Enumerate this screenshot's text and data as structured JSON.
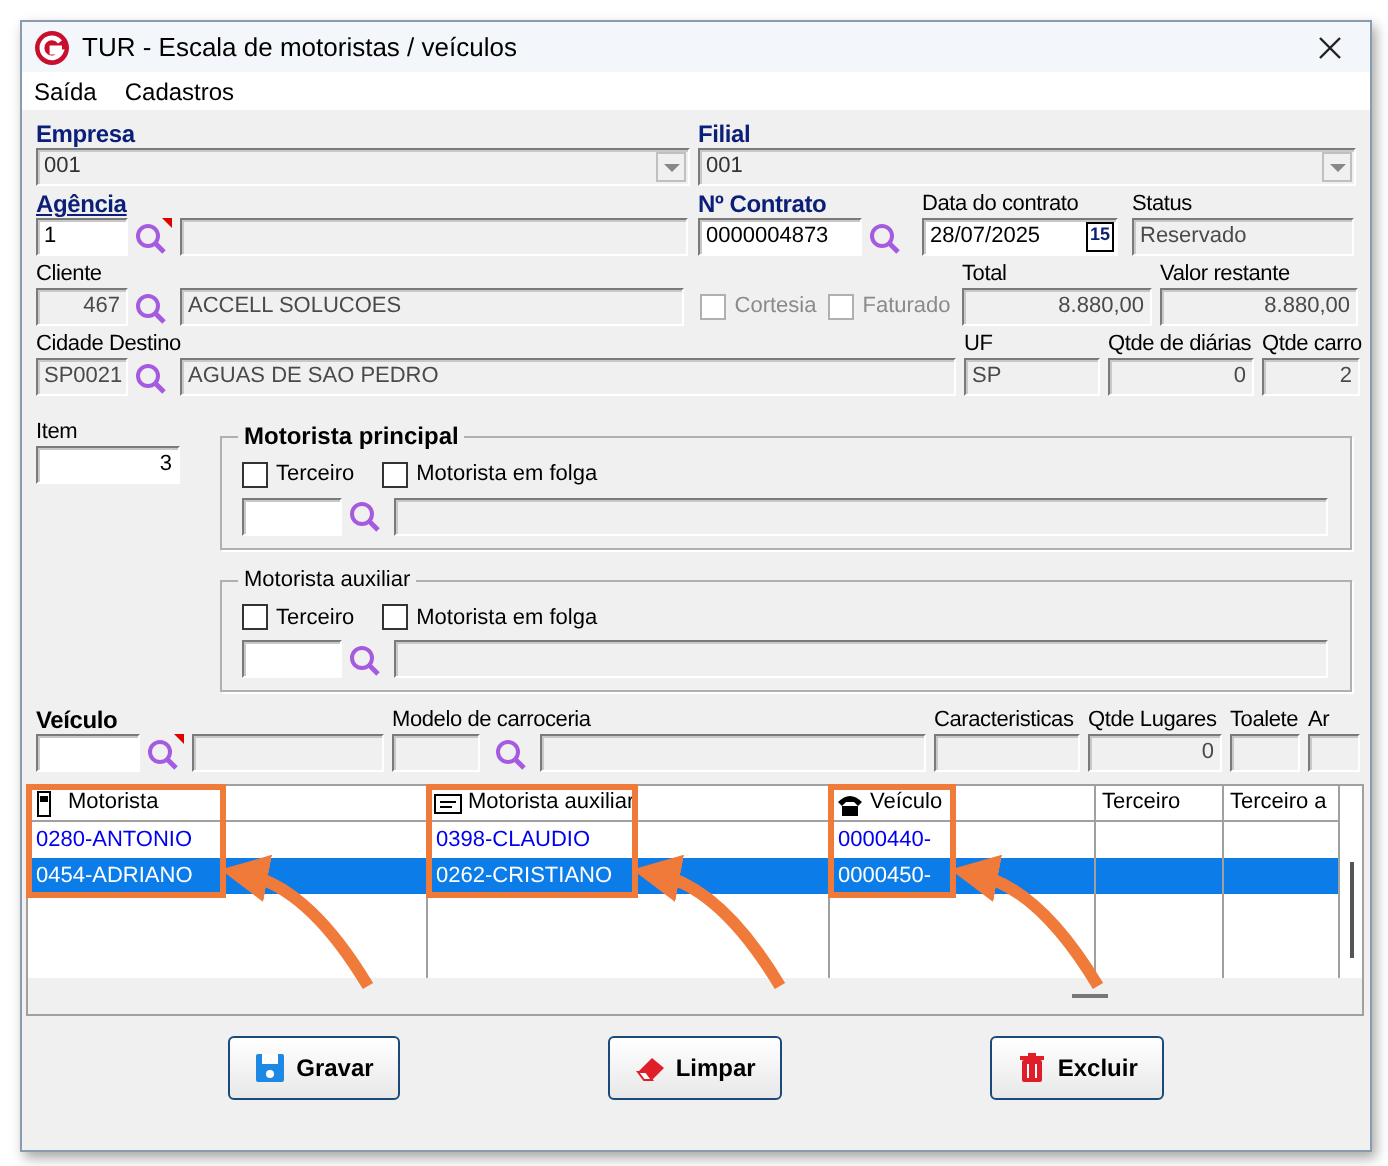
{
  "window": {
    "title": "TUR - Escala de motoristas / veículos"
  },
  "menu": [
    {
      "label": "Saída"
    },
    {
      "label": "Cadastros"
    }
  ],
  "empresa": {
    "label": "Empresa",
    "label_bold": true,
    "label_highlight": true,
    "value": "001"
  },
  "filial": {
    "label": "Filial",
    "label_bold": true,
    "label_highlight": true,
    "value": "001"
  },
  "agencia": {
    "label": "Agência",
    "label_bold": true,
    "label_highlight": true,
    "label_link": true,
    "value": "1",
    "required": true
  },
  "contrato": {
    "label": "Nº Contrato",
    "label_bold": true,
    "label_highlight": true,
    "value": "0000004873"
  },
  "data_contrato": {
    "label": "Data do contrato",
    "value": "28/07/2025",
    "calendar": "15"
  },
  "status": {
    "label": "Status",
    "value": "Reservado"
  },
  "cliente": {
    "label": "Cliente",
    "code": "467",
    "name": "ACCELL SOLUCOES"
  },
  "flags": [
    {
      "label": "Cortesia",
      "checked": false,
      "disabled": true
    },
    {
      "label": "Faturado",
      "checked": false,
      "disabled": true
    }
  ],
  "total": {
    "label": "Total",
    "value": "8.880,00"
  },
  "valor_restante": {
    "label": "Valor restante",
    "value": "8.880,00"
  },
  "cidade": {
    "label": "Cidade Destino",
    "code": "SP0021",
    "name": "AGUAS DE SAO PEDRO"
  },
  "uf": {
    "label": "UF",
    "value": "SP"
  },
  "qtde_diarias": {
    "label": "Qtde de diárias",
    "value": "0"
  },
  "qtde_carro": {
    "label": "Qtde carro",
    "value": "2"
  },
  "item": {
    "label": "Item",
    "value": "3"
  },
  "driver_groups": [
    {
      "title": "Motorista principal",
      "emphasis": true,
      "checkboxes": [
        {
          "label": "Terceiro",
          "checked": false
        },
        {
          "label": "Motorista em folga",
          "checked": false
        }
      ]
    },
    {
      "title": "Motorista auxiliar",
      "emphasis": false,
      "checkboxes": [
        {
          "label": "Terceiro",
          "checked": false
        },
        {
          "label": "Motorista em folga",
          "checked": false
        }
      ]
    }
  ],
  "veiculo": {
    "label": "Veículo",
    "label_bold": true,
    "required": true
  },
  "modelo": {
    "label": "Modelo de carroceria"
  },
  "caracteristicas": {
    "label": "Caracteristicas"
  },
  "qtde_lugares": {
    "label": "Qtde Lugares",
    "value": "0"
  },
  "toalete": {
    "label": "Toalete"
  },
  "ar": {
    "label": "Ar"
  },
  "grid": {
    "columns": [
      {
        "label": "Motorista",
        "highlighted": true
      },
      {
        "label": "Motorista auxiliar",
        "highlighted": true
      },
      {
        "label": "Veículo",
        "highlighted": true
      },
      {
        "label": "Terceiro",
        "highlighted": false
      },
      {
        "label": "Terceiro a",
        "highlighted": false
      }
    ],
    "rows": [
      {
        "cells": [
          "0280-ANTONIO",
          "0398-CLAUDIO",
          "0000440-",
          "",
          ""
        ],
        "selected": false
      },
      {
        "cells": [
          "0454-ADRIANO",
          "0262-CRISTIANO",
          "0000450-",
          "",
          ""
        ],
        "selected": true
      }
    ]
  },
  "buttons": [
    {
      "label": "Gravar",
      "kind": "save"
    },
    {
      "label": "Limpar",
      "kind": "clear"
    },
    {
      "label": "Excluir",
      "kind": "delete"
    }
  ]
}
